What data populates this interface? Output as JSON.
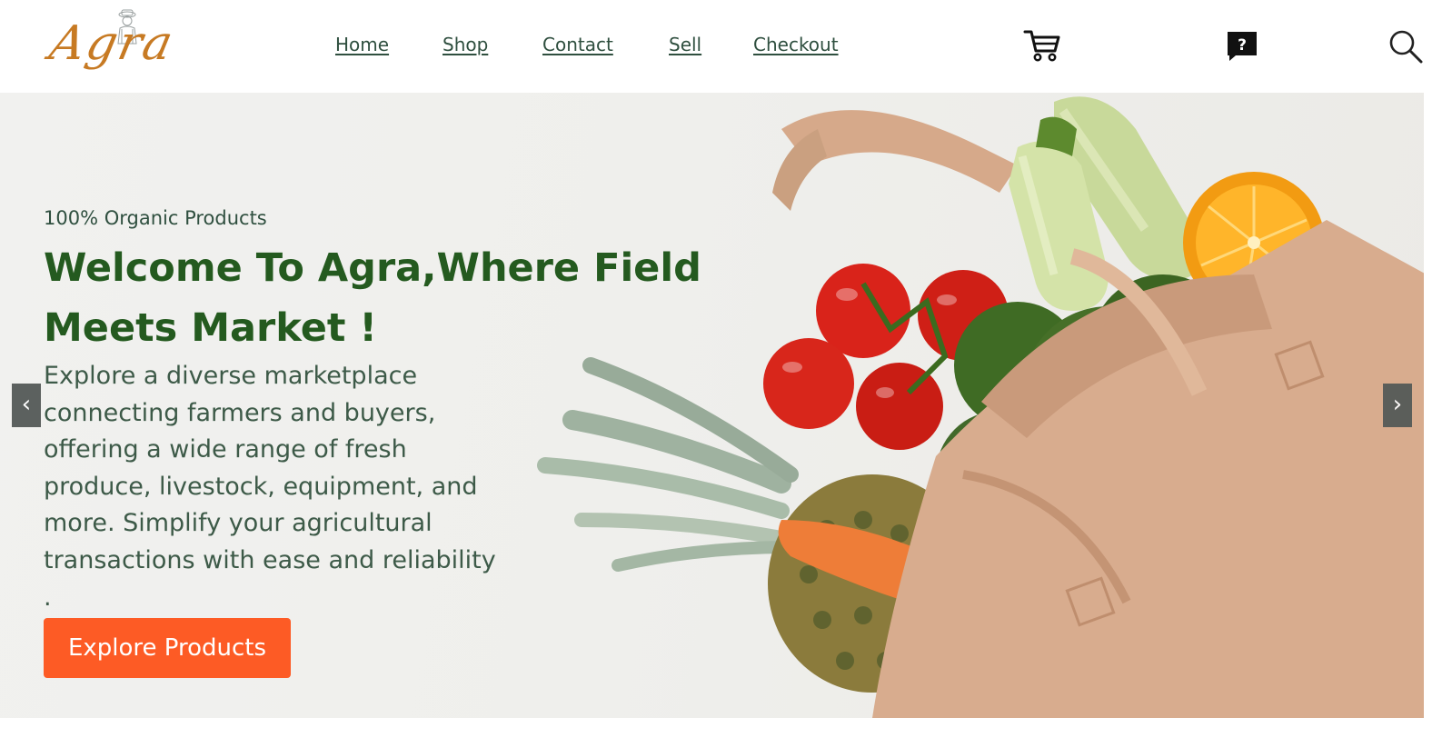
{
  "header": {
    "logo_text": "Agra",
    "nav": [
      {
        "label": "Home"
      },
      {
        "label": "Shop"
      },
      {
        "label": "Contact"
      },
      {
        "label": "Sell"
      },
      {
        "label": "Checkout"
      }
    ],
    "icons": {
      "cart": "cart-icon",
      "help": "help-chat-icon",
      "help_glyph": "?",
      "search": "search-icon"
    }
  },
  "hero": {
    "tagline": "100% Organic Products",
    "headline": "Welcome To Agra,Where Field Meets Market !",
    "description": "Explore a diverse marketplace connecting farmers and buyers, offering a wide range of fresh produce, livestock, equipment, and more. Simplify your agricultural transactions with ease and reliability .",
    "cta_label": "Explore Products",
    "prev_arrow": "‹",
    "next_arrow": "›"
  },
  "colors": {
    "accent": "#fd5b25",
    "headline": "#245a1f",
    "body_text": "#3d5a48",
    "logo": "#c77a23"
  }
}
